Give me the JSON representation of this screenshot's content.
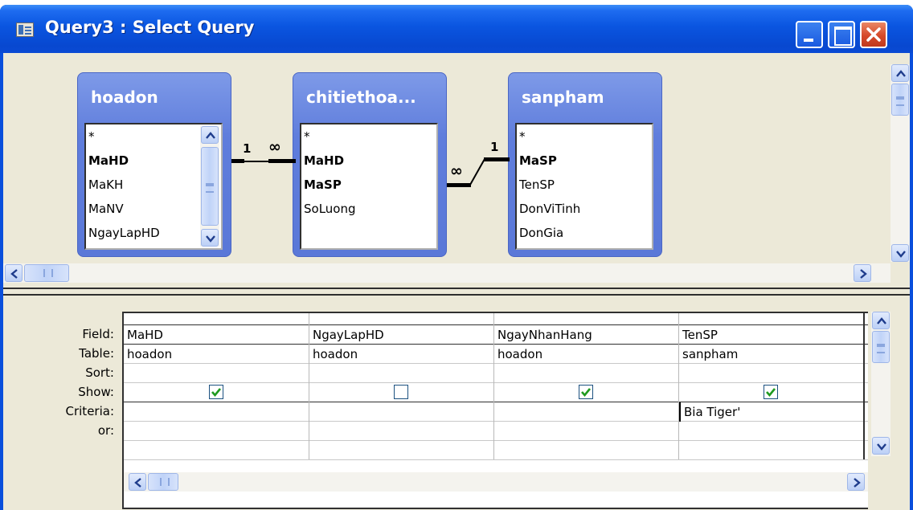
{
  "window": {
    "title": "Query3 : Select Query"
  },
  "tables": [
    {
      "name": "hoadon",
      "fields": [
        {
          "name": "*",
          "key": false
        },
        {
          "name": "MaHD",
          "key": true
        },
        {
          "name": "MaKH",
          "key": false
        },
        {
          "name": "MaNV",
          "key": false
        },
        {
          "name": "NgayLapHD",
          "key": false
        }
      ]
    },
    {
      "name": "chitiethoa...",
      "fields": [
        {
          "name": "*",
          "key": false
        },
        {
          "name": "MaHD",
          "key": true
        },
        {
          "name": "MaSP",
          "key": true
        },
        {
          "name": "SoLuong",
          "key": false
        }
      ]
    },
    {
      "name": "sanpham",
      "fields": [
        {
          "name": "*",
          "key": false
        },
        {
          "name": "MaSP",
          "key": true
        },
        {
          "name": "TenSP",
          "key": false
        },
        {
          "name": "DonViTinh",
          "key": false
        },
        {
          "name": "DonGia",
          "key": false
        }
      ]
    }
  ],
  "joins": [
    {
      "from_side": "1",
      "to_side": "∞"
    },
    {
      "from_side": "∞",
      "to_side": "1"
    }
  ],
  "grid": {
    "row_labels": {
      "field": "Field:",
      "table": "Table:",
      "sort": "Sort:",
      "show": "Show:",
      "criteria": "Criteria:",
      "or": "or:"
    },
    "columns": [
      {
        "field": "MaHD",
        "table": "hoadon",
        "sort": "",
        "show": true,
        "criteria": "",
        "or": ""
      },
      {
        "field": "NgayLapHD",
        "table": "hoadon",
        "sort": "",
        "show": false,
        "criteria": "",
        "or": ""
      },
      {
        "field": "NgayNhanHang",
        "table": "hoadon",
        "sort": "",
        "show": true,
        "criteria": "",
        "or": ""
      },
      {
        "field": "TenSP",
        "table": "sanpham",
        "sort": "",
        "show": true,
        "criteria": "Bia Tiger'",
        "or": ""
      }
    ]
  },
  "colors": {
    "titlebar": "#0a55e0",
    "table_header": "#5f7ddc",
    "check": "#1f9a1f"
  }
}
